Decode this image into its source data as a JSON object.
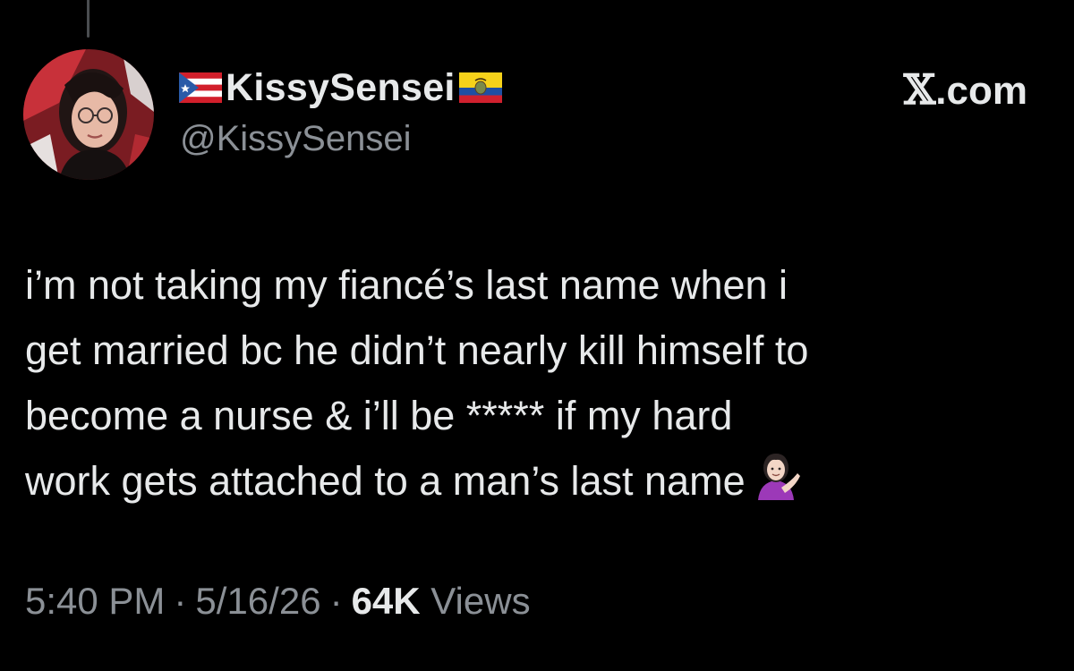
{
  "tweet": {
    "author": {
      "display_name": "KissySensei",
      "handle": "@KissySensei",
      "flag_left": "puerto-rico-flag",
      "flag_right": "ecuador-flag"
    },
    "site_label": ".com",
    "site_glyph": "𝕏",
    "text_lines": [
      "i’m not taking my fiancé’s last name when i",
      "get married bc he didn’t nearly kill himself to",
      "become a nurse & i’ll be ***** if my hard",
      "work gets attached to a man’s last name"
    ],
    "emoji": "woman-tipping-hand-emoji",
    "meta": {
      "time": "5:40 PM",
      "date": "5/16/26",
      "views_count": "64K",
      "views_label": "Views",
      "separator": "·"
    }
  },
  "colors": {
    "background": "#000000",
    "text": "#e7e9ea",
    "muted": "#8b9096"
  }
}
